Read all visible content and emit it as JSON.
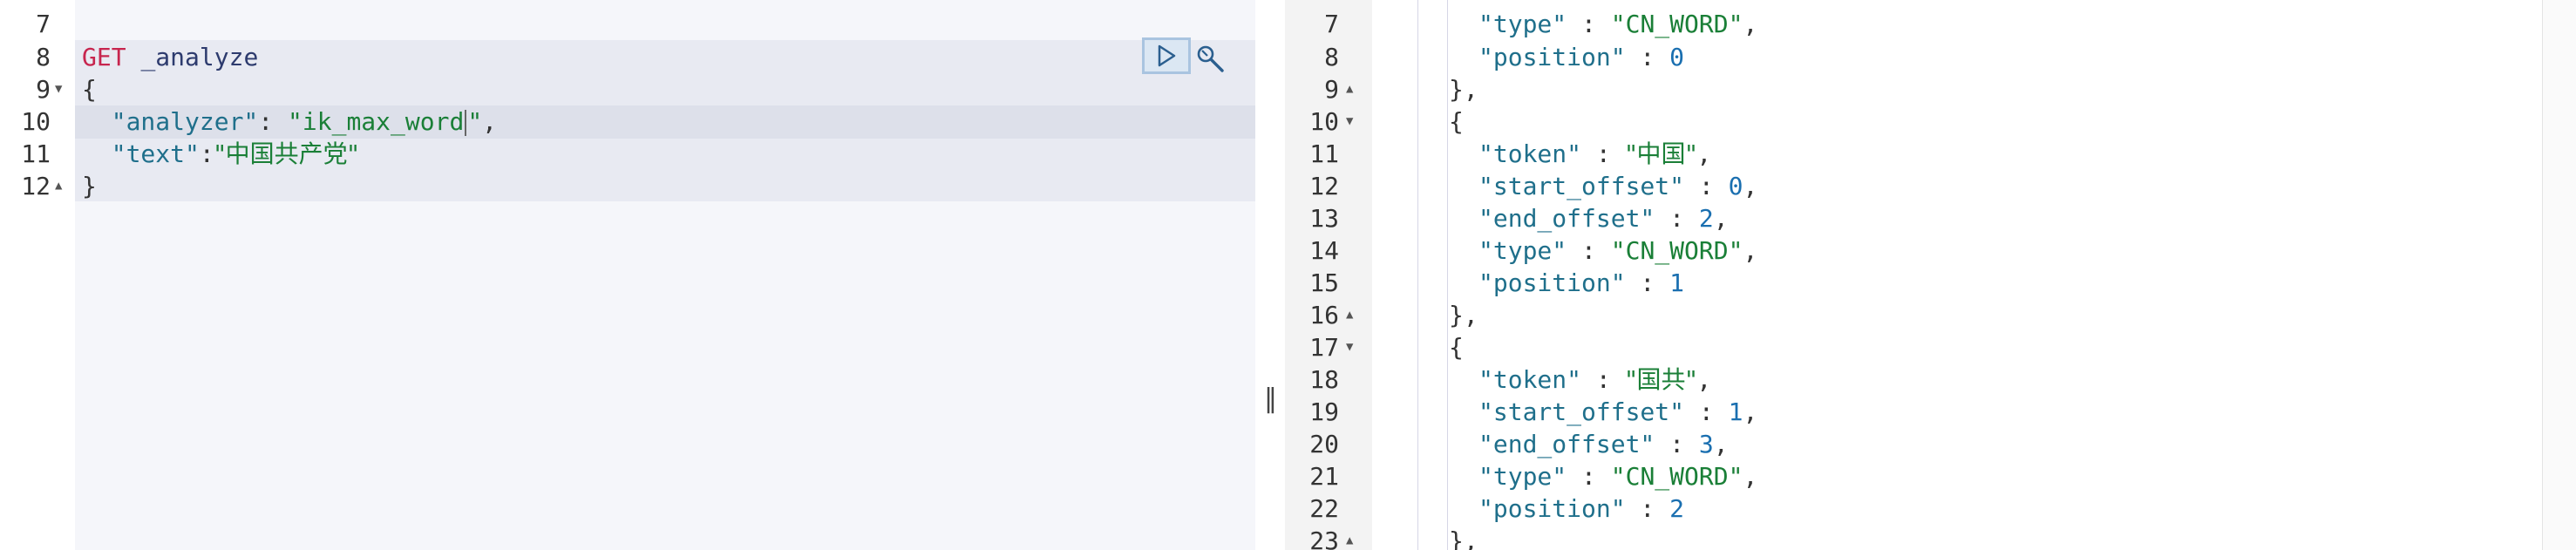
{
  "editor": {
    "request_method": "GET",
    "request_path": "_analyze",
    "line_numbers": [
      "7",
      "8",
      "9",
      "10",
      "11",
      "12"
    ],
    "body": {
      "open_brace": "{",
      "close_brace": "}",
      "analyzer_key": "\"analyzer\"",
      "analyzer_value_a": "\"ik_max_word",
      "analyzer_value_b": "\"",
      "text_key": "\"text\"",
      "text_value": "\"中国共产党\""
    }
  },
  "toolbar": {
    "run_icon": "play-icon",
    "settings_icon": "wrench-icon"
  },
  "splitter": {
    "handle_glyph": "‖"
  },
  "output": {
    "line_numbers": [
      "7",
      "8",
      "9",
      "10",
      "11",
      "12",
      "13",
      "14",
      "15",
      "16",
      "17",
      "18",
      "19",
      "20",
      "21",
      "22",
      "23"
    ],
    "fold_markers": {
      "9": "▲",
      "10": "▼",
      "16": "▲",
      "17": "▼",
      "23": "▲"
    },
    "lines": {
      "l7_key": "\"type\"",
      "l7_val": "\"CN_WORD\"",
      "l8_key": "\"position\"",
      "l8_val": "0",
      "l9": "},",
      "l10": "{",
      "l11_key": "\"token\"",
      "l11_val": "\"中国\"",
      "l12_key": "\"start_offset\"",
      "l12_val": "0",
      "l13_key": "\"end_offset\"",
      "l13_val": "2",
      "l14_key": "\"type\"",
      "l14_val": "\"CN_WORD\"",
      "l15_key": "\"position\"",
      "l15_val": "1",
      "l16": "},",
      "l17": "{",
      "l18_key": "\"token\"",
      "l18_val": "\"国共\"",
      "l19_key": "\"start_offset\"",
      "l19_val": "1",
      "l20_key": "\"end_offset\"",
      "l20_val": "3",
      "l21_key": "\"type\"",
      "l21_val": "\"CN_WORD\"",
      "l22_key": "\"position\"",
      "l22_val": "2",
      "l23": "},"
    }
  }
}
